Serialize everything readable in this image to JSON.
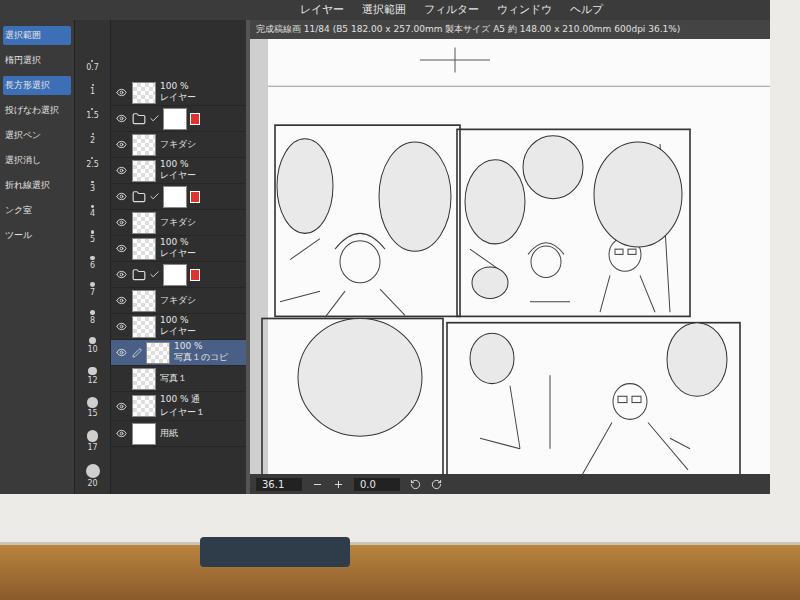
{
  "menu": [
    "レイヤー",
    "選択範囲",
    "フィルター",
    "ウィンドウ",
    "ヘルプ"
  ],
  "tools": [
    {
      "label": "選択範囲",
      "selected": true
    },
    {
      "label": "楕円選択",
      "selected": false
    },
    {
      "label": "長方形選択",
      "selected": true
    },
    {
      "label": "投げなわ選択",
      "selected": false
    },
    {
      "label": "選択ペン",
      "selected": false
    },
    {
      "label": "選択消し",
      "selected": false
    },
    {
      "label": "折れ線選択",
      "selected": false
    },
    {
      "label": "ンク室",
      "selected": false
    },
    {
      "label": "ツール",
      "selected": false
    }
  ],
  "brush_sizes": [
    "0.7",
    "1",
    "1.5",
    "2",
    "2.5",
    "3",
    "4",
    "5",
    "6",
    "7",
    "8",
    "10",
    "12",
    "15",
    "17",
    "20"
  ],
  "layers": [
    {
      "kind": "raster",
      "opacity": "100 %",
      "name": "レイヤー",
      "visible": true,
      "selected": false
    },
    {
      "kind": "folder",
      "visible": true,
      "selected": false
    },
    {
      "kind": "balloon",
      "name": "フキダシ",
      "visible": true,
      "selected": false
    },
    {
      "kind": "raster",
      "opacity": "100 %",
      "name": "レイヤー",
      "visible": true,
      "selected": false
    },
    {
      "kind": "folder",
      "visible": true,
      "selected": false
    },
    {
      "kind": "balloon",
      "name": "フキダシ",
      "visible": true,
      "selected": false
    },
    {
      "kind": "raster",
      "opacity": "100 %",
      "name": "レイヤー",
      "visible": true,
      "selected": false
    },
    {
      "kind": "folder",
      "visible": true,
      "selected": false
    },
    {
      "kind": "balloon",
      "name": "フキダシ",
      "visible": true,
      "selected": false
    },
    {
      "kind": "raster",
      "opacity": "100 %",
      "name": "レイヤー",
      "visible": true,
      "selected": false
    },
    {
      "kind": "raster",
      "opacity": "100 %",
      "name": "写真１のコピ",
      "visible": true,
      "selected": true
    },
    {
      "kind": "raster",
      "name": "写真１",
      "visible": false,
      "selected": false
    },
    {
      "kind": "raster",
      "opacity": "100 % 通",
      "name": "レイヤー１",
      "visible": true,
      "selected": false
    },
    {
      "kind": "paper",
      "name": "用紙",
      "visible": true,
      "selected": false
    }
  ],
  "document": {
    "title": "完成稿線画 11/84 (B5 182.00 x 257.00mm 製本サイズ A5 約 148.00 x 210.00mm 600dpi 36.1%)",
    "zoom": "36.1",
    "angle": "0.0"
  }
}
